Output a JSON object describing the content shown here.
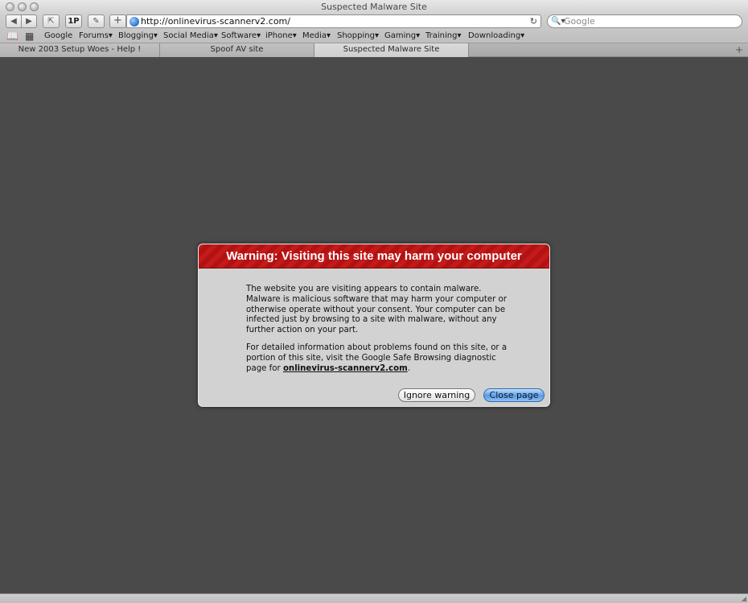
{
  "window": {
    "title": "Suspected Malware Site"
  },
  "toolbar": {
    "back_icon": "◀",
    "forward_icon": "▶",
    "snapback_icon": "⇱",
    "onepassword_label": "1P",
    "evernote_icon": "✎",
    "add_icon": "+",
    "url": "http://onlinevirus-scannerv2.com/",
    "reload_icon": "↻",
    "search_icon": "🔍▾",
    "search_placeholder": "Google"
  },
  "bookmarks": {
    "book_icon": "📖",
    "grid_icon": "▦",
    "items": [
      {
        "label": "Google"
      },
      {
        "label": "Forums▾"
      },
      {
        "label": "Blogging▾"
      },
      {
        "label": "Social Media▾"
      },
      {
        "label": "Software▾"
      },
      {
        "label": "iPhone▾"
      },
      {
        "label": "Media▾"
      },
      {
        "label": "Shopping▾"
      },
      {
        "label": "Gaming▾"
      },
      {
        "label": "Training▾"
      },
      {
        "label": "Downloading▾"
      }
    ]
  },
  "tabs": {
    "items": [
      {
        "label": "New 2003 Setup Woes - Help !"
      },
      {
        "label": "Spoof AV site"
      },
      {
        "label": "Suspected Malware Site"
      }
    ],
    "add_icon": "+"
  },
  "dialog": {
    "title": "Warning: Visiting this site may harm your computer",
    "paragraph1": "The website you are visiting appears to contain malware. Malware is malicious software that may harm your computer or otherwise operate without your consent. Your computer can be infected just by browsing to a site with malware, without any further action on your part.",
    "paragraph2_prefix": "For detailed information about problems found on this site, or a portion of this site, visit the Google Safe Browsing diagnostic page for ",
    "domain_link": "onlinevirus-scannerv2.com",
    "paragraph2_suffix": ".",
    "ignore_label": "Ignore warning",
    "close_label": "Close page",
    "accent_color": "#c41a1a"
  }
}
